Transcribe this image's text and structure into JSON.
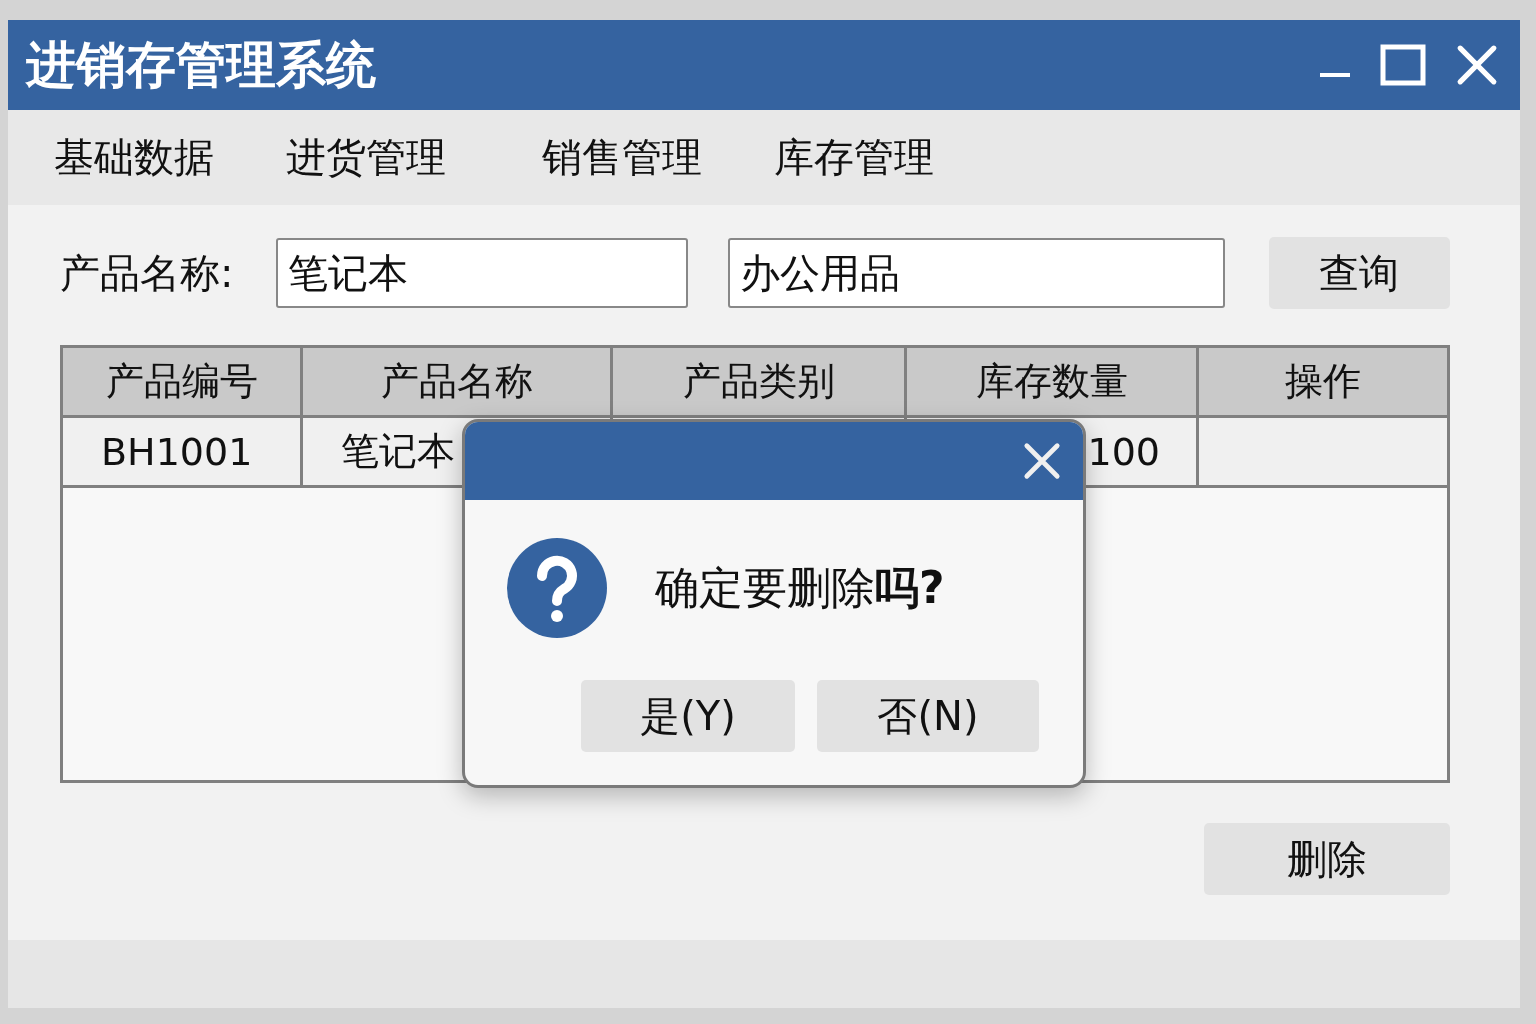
{
  "window": {
    "title": "进销存管理系统"
  },
  "menu": [
    {
      "label": "基础数据"
    },
    {
      "label": "进货管理"
    },
    {
      "label": "销售管理"
    },
    {
      "label": "库存管理"
    }
  ],
  "search": {
    "label": "产品名称:",
    "name_value": "笔记本",
    "category_value": "办公用品",
    "button": "查询"
  },
  "table": {
    "columns": [
      "产品编号",
      "产品名称",
      "产品类别",
      "库存数量",
      "操作"
    ],
    "rows": [
      {
        "cells": [
          "BH1001",
          "笔记本",
          null,
          "100",
          null
        ]
      }
    ]
  },
  "delete_button": "删除",
  "dialog": {
    "message": "确定要删除**吗?**",
    "buttons": [
      "是(Y)",
      "否(N)"
    ]
  }
}
